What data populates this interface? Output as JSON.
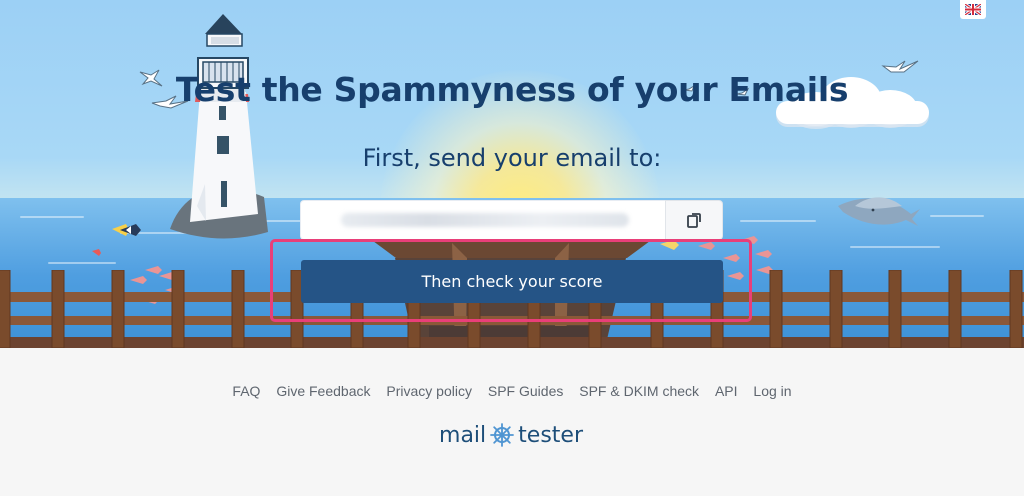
{
  "header": {
    "language_button": "UK flag"
  },
  "hero": {
    "title": "Test the Spammyness of your Emails",
    "subtitle": "First, send your email to:",
    "email_value": "",
    "copy_icon": "copy-icon",
    "check_button": "Then check your score"
  },
  "footer": {
    "links": [
      "FAQ",
      "Give Feedback",
      "Privacy policy",
      "SPF Guides",
      "SPF & DKIM check",
      "API",
      "Log in"
    ],
    "brand_left": "mail",
    "brand_right": "tester"
  },
  "colors": {
    "heading": "#173f6d",
    "button": "#255486",
    "highlight": "#e93f79",
    "wood": "#7a4b2c",
    "sky": "#a8d8f6",
    "sea": "#4f9ee0"
  }
}
